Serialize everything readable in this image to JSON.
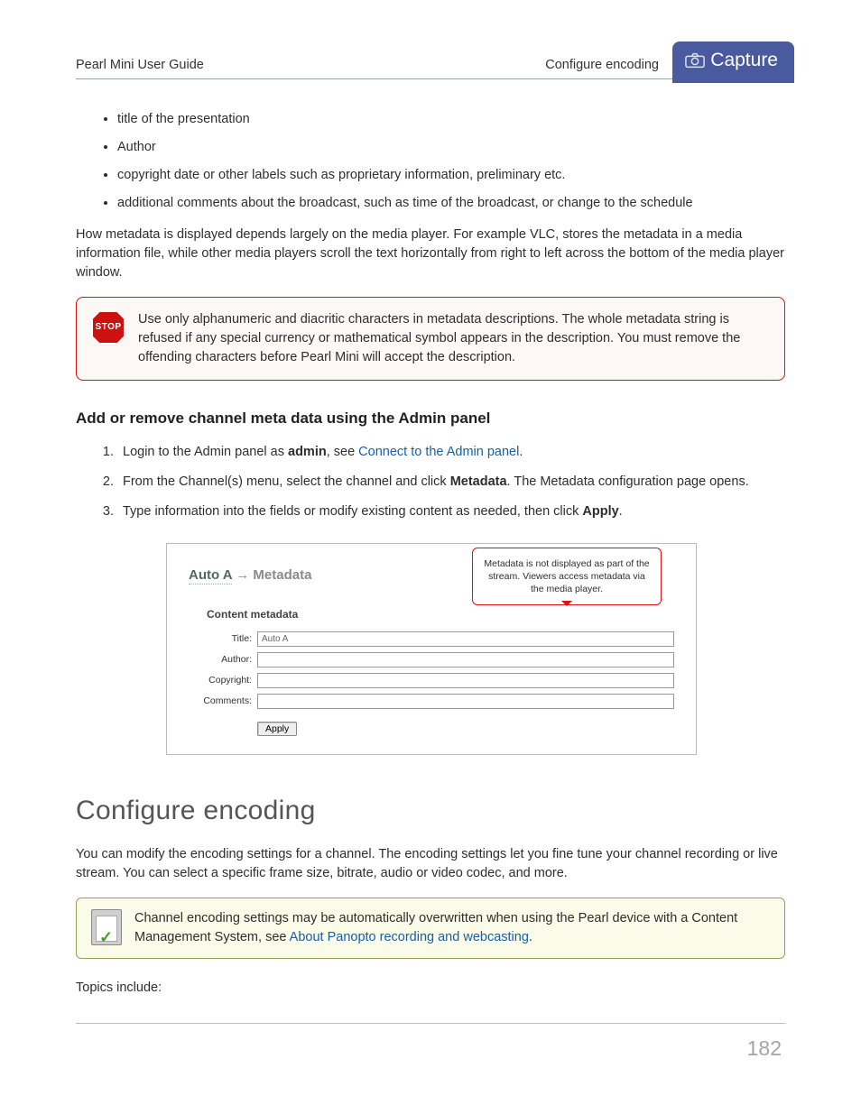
{
  "header": {
    "left": "Pearl Mini User Guide",
    "right": "Configure encoding",
    "tab": "Capture"
  },
  "bullets": [
    "title of the presentation",
    "Author",
    "copyright date or other labels such as proprietary information, preliminary etc.",
    "additional comments about the broadcast, such as time of the broadcast, or change to the schedule"
  ],
  "para1": "How metadata is displayed depends largely on the media player. For example VLC, stores the metadata in a media information file, while other media players scroll the text horizontally from right to left across the bottom of the media player window.",
  "stop": {
    "badge": "STOP",
    "text": "Use only alphanumeric and diacritic characters in metadata descriptions. The whole metadata string is refused if any special currency or mathematical symbol appears in the description. You must remove the offending characters before Pearl Mini will accept the description."
  },
  "subheading": "Add or remove channel meta data using the Admin panel",
  "steps": {
    "s1_a": "Login to the Admin panel as ",
    "s1_bold": "admin",
    "s1_b": ", see ",
    "s1_link": "Connect to the Admin panel",
    "s1_c": ".",
    "s2_a": "From the Channel(s) menu, select the channel and click ",
    "s2_bold": "Metadata",
    "s2_b": ". The Metadata configuration page opens.",
    "s3_a": "Type information into the fields or modify existing content as needed, then click ",
    "s3_bold": "Apply",
    "s3_b": "."
  },
  "mock": {
    "crumb_a": "Auto A",
    "arrow": " → ",
    "crumb_b": "Metadata",
    "subhead": "Content metadata",
    "balloon": "Metadata is not displayed as part of the stream. Viewers access metadata via the media player.",
    "labels": {
      "title": "Title:",
      "author": "Author:",
      "copyright": "Copyright:",
      "comments": "Comments:"
    },
    "title_value": "Auto A",
    "apply": "Apply"
  },
  "section_heading": "Configure encoding",
  "para2": "You can modify the encoding settings for a channel. The encoding settings let you fine tune your channel recording or live stream. You can select a specific frame size, bitrate, audio or video codec, and more.",
  "tip": {
    "text_a": "Channel encoding settings may be automatically overwritten when using the Pearl device with a Content Management System, see ",
    "link": "About Panopto recording and webcasting",
    "text_b": "."
  },
  "topics_label": "Topics include:",
  "page_number": "182"
}
